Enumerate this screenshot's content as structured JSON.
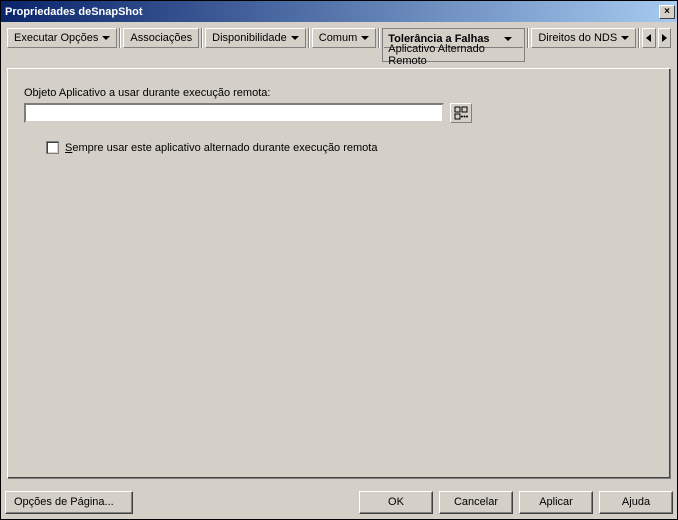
{
  "window": {
    "title": "Propriedades deSnapShot",
    "close_symbol": "×"
  },
  "tabs": {
    "items": [
      {
        "label": "Executar Opções"
      },
      {
        "label": "Associações",
        "has_caret": false
      },
      {
        "label": "Disponibilidade"
      },
      {
        "label": "Comum"
      }
    ],
    "active": {
      "label": "Tolerância a Falhas",
      "subtab": "Aplicativo Alternado Remoto"
    },
    "after": [
      {
        "label": "Direitos do NDS"
      }
    ]
  },
  "form": {
    "object_label": "Objeto Aplicativo a usar durante execução remota:",
    "object_value": "",
    "always_use_label_prefix": "S",
    "always_use_label_rest": "empre usar este aplicativo alternado durante execução remota"
  },
  "buttons": {
    "page_options": "Opções de Página...",
    "ok": "OK",
    "cancel": "Cancelar",
    "apply": "Aplicar",
    "help": "Ajuda"
  }
}
